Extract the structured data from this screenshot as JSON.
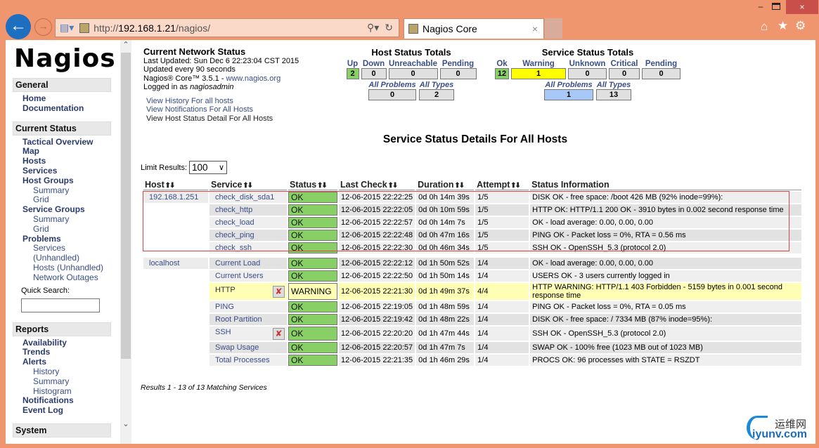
{
  "browser": {
    "url_prefix": "http://",
    "url_host": "192.168.1.21",
    "url_path": "/nagios/",
    "tab_title": "Nagios Core"
  },
  "sidebar": {
    "logo": "Nagios",
    "sections": [
      {
        "title": "General",
        "items": [
          {
            "label": "Home",
            "level": 1
          },
          {
            "label": "Documentation",
            "level": 1
          }
        ]
      },
      {
        "title": "Current Status",
        "items": [
          {
            "label": "Tactical Overview",
            "level": 1
          },
          {
            "label": "Map",
            "level": 1
          },
          {
            "label": "Hosts",
            "level": 1
          },
          {
            "label": "Services",
            "level": 1
          },
          {
            "label": "Host Groups",
            "level": 1
          },
          {
            "label": "Summary",
            "level": 2
          },
          {
            "label": "Grid",
            "level": 2
          },
          {
            "label": "Service Groups",
            "level": 1
          },
          {
            "label": "Summary",
            "level": 2
          },
          {
            "label": "Grid",
            "level": 2
          },
          {
            "label": "Problems",
            "level": 1
          },
          {
            "label": "Services",
            "level": 2
          },
          {
            "label": "(Unhandled)",
            "level": 2
          },
          {
            "label": "Hosts (Unhandled)",
            "level": 2
          },
          {
            "label": "Network Outages",
            "level": 2
          }
        ]
      },
      {
        "title": "Reports",
        "items": [
          {
            "label": "Availability",
            "level": 1
          },
          {
            "label": "Trends",
            "level": 1
          },
          {
            "label": "Alerts",
            "level": 1
          },
          {
            "label": "History",
            "level": 2
          },
          {
            "label": "Summary",
            "level": 2
          },
          {
            "label": "Histogram",
            "level": 2
          },
          {
            "label": "Notifications",
            "level": 1
          },
          {
            "label": "Event Log",
            "level": 1
          }
        ]
      },
      {
        "title": "System",
        "items": []
      }
    ],
    "quick_search_label": "Quick Search:",
    "quick_search_value": ""
  },
  "status": {
    "title": "Current Network Status",
    "last_updated": "Last Updated: Sun Dec 6 22:23:04 CST 2015",
    "interval": "Updated every 90 seconds",
    "version": "Nagios® Core™ 3.5.1 - ",
    "version_link": "www.nagios.org",
    "logged_prefix": "Logged in as ",
    "user": "nagiosadmin",
    "links": [
      "View History For all hosts",
      "View Notifications For All Hosts",
      "View Host Status Detail For All Hosts"
    ]
  },
  "host_totals": {
    "title": "Host Status Totals",
    "labels": [
      "Up",
      "Down",
      "Unreachable",
      "Pending"
    ],
    "values": [
      "2",
      "0",
      "0",
      "0"
    ],
    "sub_labels": [
      "All Problems",
      "All Types"
    ],
    "sub_values": [
      "0",
      "2"
    ]
  },
  "service_totals": {
    "title": "Service Status Totals",
    "labels": [
      "Ok",
      "Warning",
      "Unknown",
      "Critical",
      "Pending"
    ],
    "values": [
      "12",
      "1",
      "0",
      "0",
      "0"
    ],
    "sub_labels": [
      "All Problems",
      "All Types"
    ],
    "sub_values": [
      "1",
      "13"
    ]
  },
  "details": {
    "title": "Service Status Details For All Hosts",
    "limit_label": "Limit Results:",
    "limit_value": "100",
    "columns": [
      "Host",
      "Service",
      "Status",
      "Last Check",
      "Duration",
      "Attempt",
      "Status Information"
    ],
    "rows": [
      {
        "host": "192.168.1.251",
        "service": "check_disk_sda1",
        "status": "OK",
        "last": "12-06-2015 22:22:25",
        "dur": "0d 0h 14m 39s",
        "att": "1/5",
        "info": "DISK OK - free space: /boot 426 MB (92% inode=99%):"
      },
      {
        "host": "",
        "service": "check_http",
        "status": "OK",
        "last": "12-06-2015 22:22:05",
        "dur": "0d 0h 10m 59s",
        "att": "1/5",
        "info": "HTTP OK: HTTP/1.1 200 OK - 3910 bytes in 0.002 second response time"
      },
      {
        "host": "",
        "service": "check_load",
        "status": "OK",
        "last": "12-06-2015 22:22:57",
        "dur": "0d 0h 14m 7s",
        "att": "1/5",
        "info": "OK - load average: 0.00, 0.00, 0.00"
      },
      {
        "host": "",
        "service": "check_ping",
        "status": "OK",
        "last": "12-06-2015 22:22:48",
        "dur": "0d 0h 47m 16s",
        "att": "1/5",
        "info": "PING OK - Packet loss = 0%, RTA = 0.56 ms"
      },
      {
        "host": "",
        "service": "check_ssh",
        "status": "OK",
        "last": "12-06-2015 22:22:30",
        "dur": "0d 0h 46m 34s",
        "att": "1/5",
        "info": "SSH OK - OpenSSH_5.3 (protocol 2.0)"
      },
      {
        "host": "localhost",
        "service": "Current Load",
        "status": "OK",
        "last": "12-06-2015 22:22:12",
        "dur": "0d 1h 50m 52s",
        "att": "1/4",
        "info": "OK - load average: 0.00, 0.00, 0.00"
      },
      {
        "host": "",
        "service": "Current Users",
        "status": "OK",
        "last": "12-06-2015 22:22:50",
        "dur": "0d 1h 50m 14s",
        "att": "1/4",
        "info": "USERS OK - 3 users currently logged in"
      },
      {
        "host": "",
        "service": "HTTP",
        "status": "WARNING",
        "last": "12-06-2015 22:21:30",
        "dur": "0d 1h 49m 37s",
        "att": "4/4",
        "info": "HTTP WARNING: HTTP/1.1 403 Forbidden - 5159 bytes in 0.001 second response time",
        "notif_disabled": true
      },
      {
        "host": "",
        "service": "PING",
        "status": "OK",
        "last": "12-06-2015 22:19:05",
        "dur": "0d 1h 48m 59s",
        "att": "1/4",
        "info": "PING OK - Packet loss = 0%, RTA = 0.05 ms"
      },
      {
        "host": "",
        "service": "Root Partition",
        "status": "OK",
        "last": "12-06-2015 22:19:42",
        "dur": "0d 1h 48m 22s",
        "att": "1/4",
        "info": "DISK OK - free space: / 7334 MB (87% inode=95%):"
      },
      {
        "host": "",
        "service": "SSH",
        "status": "OK",
        "last": "12-06-2015 22:20:20",
        "dur": "0d 1h 47m 44s",
        "att": "1/4",
        "info": "SSH OK - OpenSSH_5.3 (protocol 2.0)",
        "notif_disabled": true
      },
      {
        "host": "",
        "service": "Swap Usage",
        "status": "OK",
        "last": "12-06-2015 22:20:57",
        "dur": "0d 1h 47m 7s",
        "att": "1/4",
        "info": "SWAP OK - 100% free (1023 MB out of 1023 MB)"
      },
      {
        "host": "",
        "service": "Total Processes",
        "status": "OK",
        "last": "12-06-2015 22:21:35",
        "dur": "0d 1h 46m 29s",
        "att": "1/4",
        "info": "PROCS OK: 96 processes with STATE = RSZDT"
      }
    ],
    "footer": "Results 1 - 13 of 13 Matching Services"
  },
  "watermark": {
    "cn": "运维网",
    "en": "iyunv.com"
  },
  "colors": {
    "ok": "#88d066",
    "warning": "#ffff00",
    "frame": "#f0966e"
  }
}
